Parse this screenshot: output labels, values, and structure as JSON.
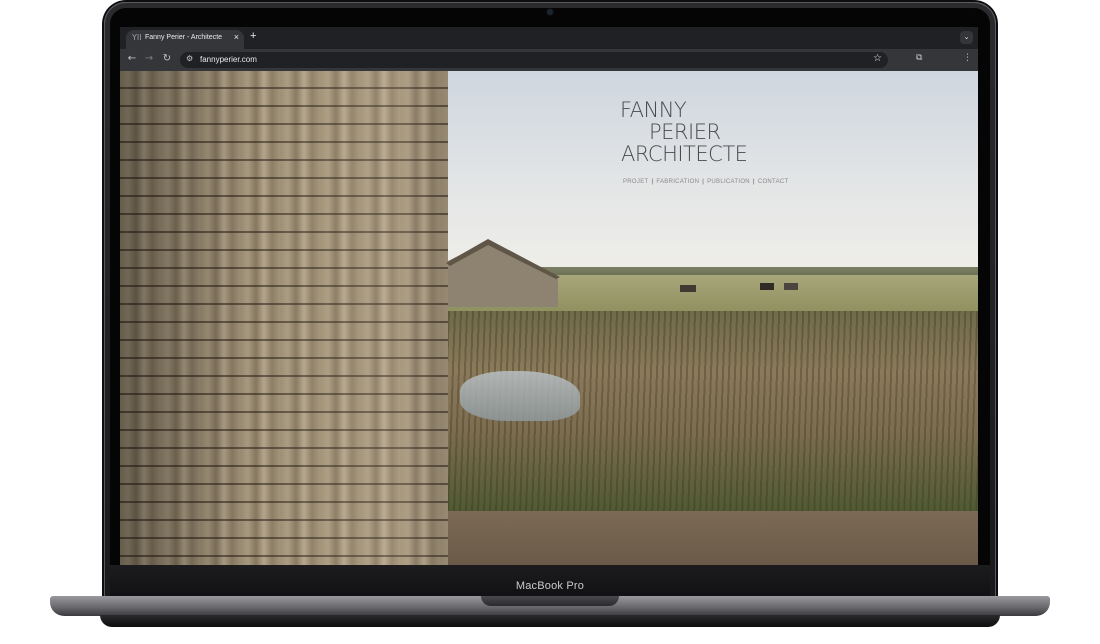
{
  "browser": {
    "tab": {
      "favicon": "YII",
      "title": "Fanny Perier - Architecte",
      "close_icon": "×"
    },
    "new_tab_icon": "+",
    "tab_list_icon": "⌄",
    "nav": {
      "back": "←",
      "forward": "→",
      "reload": "↻"
    },
    "address": {
      "url": "fannyperier.com",
      "site_info_icon": "⚙",
      "bookmark_icon": "☆"
    },
    "toolbar_icons": {
      "extensions": "⧉",
      "menu": "⋮"
    }
  },
  "page": {
    "brand_lines": [
      "FANNY",
      "PERIER",
      "ARCHITECTE"
    ],
    "menu": [
      "PROJET",
      "FABRICATION",
      "PUBLICATION",
      "CONTACT"
    ],
    "menu_separator": "|"
  },
  "device": {
    "label": "MacBook Pro"
  }
}
